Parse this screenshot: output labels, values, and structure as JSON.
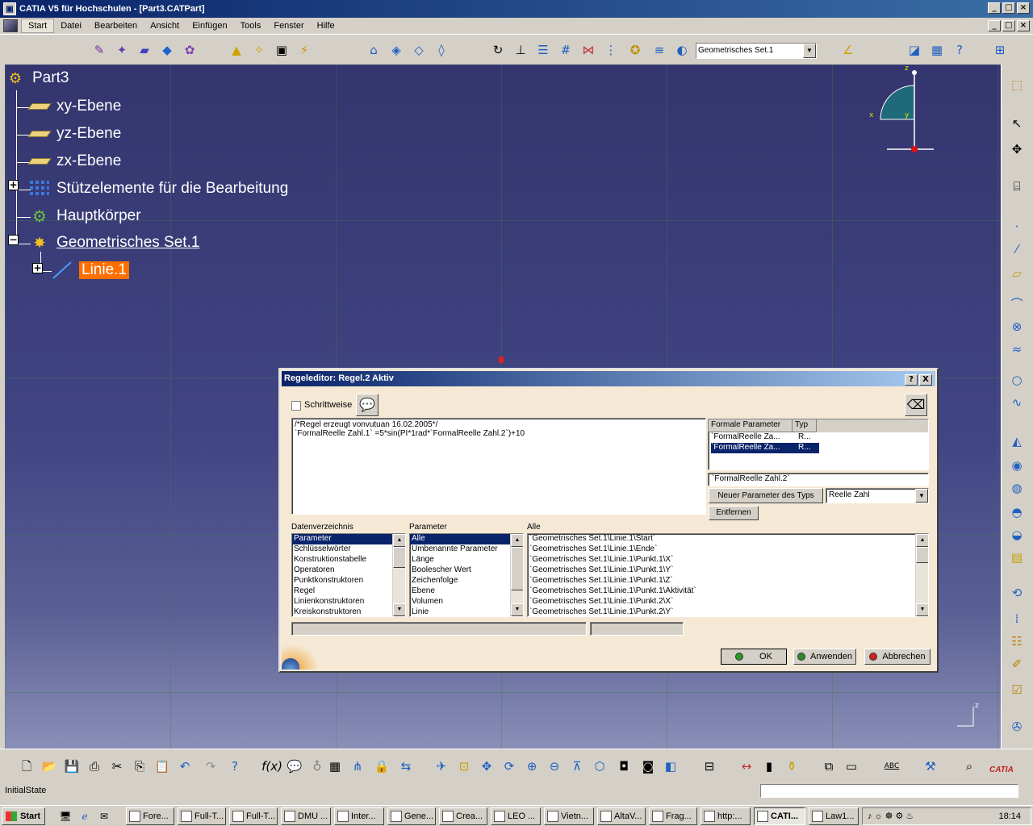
{
  "window": {
    "title": "CATIA V5 für Hochschulen - [Part3.CATPart]"
  },
  "menu": {
    "items": [
      "Start",
      "Datei",
      "Bearbeiten",
      "Ansicht",
      "Einfügen",
      "Tools",
      "Fenster",
      "Hilfe"
    ],
    "active": "Start"
  },
  "toolbar_top": {
    "geoset_selected": "Geometrisches Set.1"
  },
  "tree": {
    "root": "Part3",
    "nodes": [
      {
        "label": "xy-Ebene",
        "icon": "plane-icon"
      },
      {
        "label": "yz-Ebene",
        "icon": "plane-icon"
      },
      {
        "label": "zx-Ebene",
        "icon": "plane-icon"
      },
      {
        "label": "Stützelemente für die Bearbeitung",
        "icon": "grid-icon"
      },
      {
        "label": "Hauptkörper",
        "icon": "body-gear-icon"
      },
      {
        "label": "Geometrisches Set.1",
        "icon": "geoset-icon"
      },
      {
        "label": "Linie.1",
        "icon": "line-icon"
      }
    ]
  },
  "compass": {
    "labels": [
      "z",
      "x",
      "y"
    ],
    "axis_label_bottom": "z"
  },
  "dialog": {
    "title": "Regeleditor: Regel.2 Aktiv",
    "help_button": "?",
    "close_button": "X",
    "step_label": "Schrittweise",
    "step_checked": false,
    "editor_line1": "/*Regel erzeugt vonvutuan 16.02.2005*/",
    "editor_line2": "`FormalReelle Zahl.1` =5*sin(PI*1rad*`FormalReelle Zahl.2`)+10",
    "formal_params": {
      "headers": [
        "Formale Parameter",
        "Typ"
      ],
      "rows": [
        {
          "name": "`FormalReelle Za...",
          "type": "R...",
          "selected": false
        },
        {
          "name": "`FormalReelle Za...",
          "type": "R...",
          "selected": true
        }
      ]
    },
    "formal_value": "`FormalReelle Zahl.2`",
    "new_param_button": "Neuer Parameter des Typs",
    "type_selected": "Reelle Zahl",
    "remove_button": "Entfernen",
    "lists": {
      "dictionary": {
        "label": "Datenverzeichnis",
        "items": [
          "Parameter",
          "Schlüsselwörter",
          "Konstruktionstabelle",
          "Operatoren",
          "Punktkonstruktoren",
          "Regel",
          "Linienkonstruktoren",
          "Kreiskonstruktoren"
        ],
        "selected": 0
      },
      "parameter": {
        "label": "Parameter",
        "items": [
          "Alle",
          "Umbenannte Parameter",
          "Länge",
          "Boolescher Wert",
          "Zeichenfolge",
          "Ebene",
          "Volumen",
          "Linie"
        ],
        "selected": 0
      },
      "all": {
        "label": "Alle",
        "items": [
          "`Geometrisches Set.1\\Linie.1\\Start`",
          "`Geometrisches Set.1\\Linie.1\\Ende`",
          "`Geometrisches Set.1\\Linie.1\\Punkt.1\\X`",
          "`Geometrisches Set.1\\Linie.1\\Punkt.1\\Y`",
          "`Geometrisches Set.1\\Linie.1\\Punkt.1\\Z`",
          "`Geometrisches Set.1\\Linie.1\\Punkt.1\\Aktivität`",
          "`Geometrisches Set.1\\Linie.1\\Punkt.2\\X`",
          "`Geometrisches Set.1\\Linie.1\\Punkt.2\\Y`"
        ]
      }
    },
    "ok": "OK",
    "apply": "Anwenden",
    "cancel": "Abbrechen",
    "colors": {
      "ok_dot": "#2a9a2a",
      "apply_dot": "#2a8a2a",
      "cancel_dot": "#d02020"
    }
  },
  "status": {
    "text": "InitialState"
  },
  "taskbar": {
    "start": "Start",
    "tasks": [
      "Fore...",
      "Full-T...",
      "Full-T...",
      "DMU ...",
      "Inter...",
      "Gene...",
      "Crea...",
      "LEO ...",
      "Vietn...",
      "AltaV...",
      "Frag...",
      "http:...",
      "CATI...",
      "Law1..."
    ],
    "active_index": 12,
    "clock": "18:14"
  },
  "brand": {
    "logo_text": "CATIA"
  }
}
